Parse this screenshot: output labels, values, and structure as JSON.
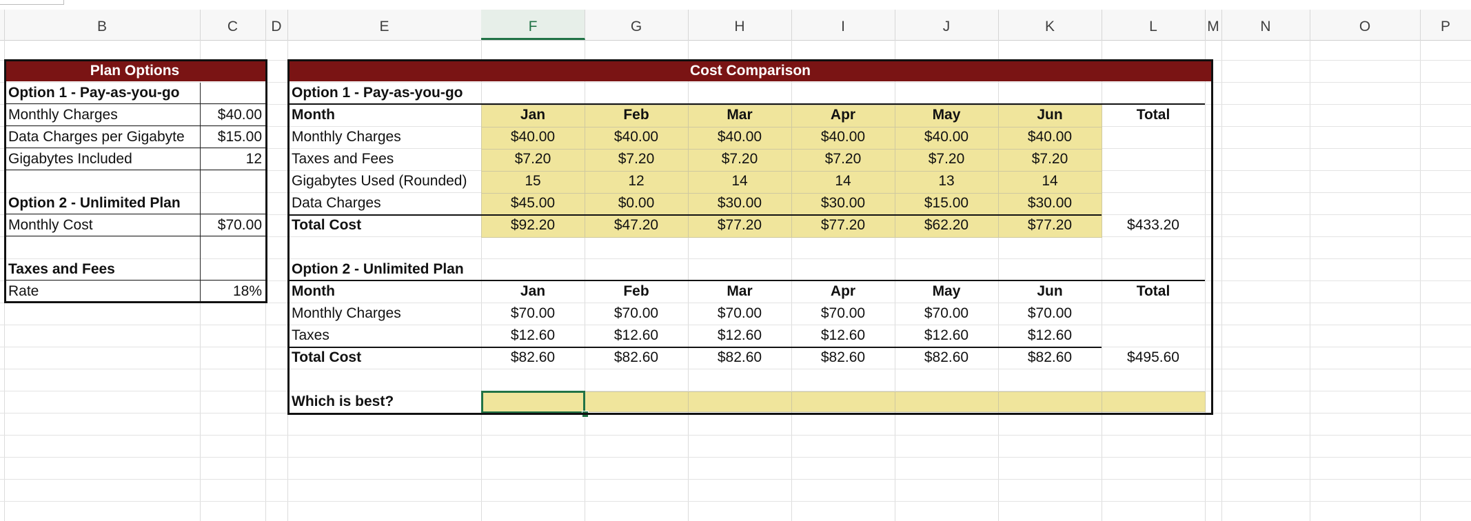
{
  "columns": [
    "B",
    "C",
    "D",
    "E",
    "F",
    "G",
    "H",
    "I",
    "J",
    "K",
    "L",
    "M",
    "N",
    "O",
    "P"
  ],
  "plan_options": {
    "title": "Plan Options",
    "opt1_label": "Option 1 - Pay-as-you-go",
    "monthly_charges_label": "Monthly Charges",
    "monthly_charges_value": "$40.00",
    "data_charges_label": "Data Charges per Gigabyte",
    "data_charges_value": "$15.00",
    "gb_included_label": "Gigabytes Included",
    "gb_included_value": "12",
    "opt2_label": "Option 2 - Unlimited Plan",
    "monthly_cost_label": "Monthly Cost",
    "monthly_cost_value": "$70.00",
    "taxes_label": "Taxes and Fees",
    "rate_label": "Rate",
    "rate_value": "18%"
  },
  "comparison": {
    "title": "Cost Comparison",
    "opt1": {
      "label": "Option 1 - Pay-as-you-go",
      "month_label": "Month",
      "months": [
        "Jan",
        "Feb",
        "Mar",
        "Apr",
        "May",
        "Jun"
      ],
      "total_label": "Total",
      "rows": [
        {
          "label": "Monthly Charges",
          "values": [
            "$40.00",
            "$40.00",
            "$40.00",
            "$40.00",
            "$40.00",
            "$40.00"
          ]
        },
        {
          "label": "Taxes and Fees",
          "values": [
            "$7.20",
            "$7.20",
            "$7.20",
            "$7.20",
            "$7.20",
            "$7.20"
          ]
        },
        {
          "label": "Gigabytes Used (Rounded)",
          "values": [
            "15",
            "12",
            "14",
            "14",
            "13",
            "14"
          ]
        },
        {
          "label": "Data Charges",
          "values": [
            "$45.00",
            "$0.00",
            "$30.00",
            "$30.00",
            "$15.00",
            "$30.00"
          ]
        }
      ],
      "total_cost_label": "Total Cost",
      "total_cost_values": [
        "$92.20",
        "$47.20",
        "$77.20",
        "$77.20",
        "$62.20",
        "$77.20"
      ],
      "grand_total": "$433.20"
    },
    "opt2": {
      "label": "Option 2 - Unlimited Plan",
      "month_label": "Month",
      "months": [
        "Jan",
        "Feb",
        "Mar",
        "Apr",
        "May",
        "Jun"
      ],
      "total_label": "Total",
      "rows": [
        {
          "label": "Monthly Charges",
          "values": [
            "$70.00",
            "$70.00",
            "$70.00",
            "$70.00",
            "$70.00",
            "$70.00"
          ]
        },
        {
          "label": "Taxes",
          "values": [
            "$12.60",
            "$12.60",
            "$12.60",
            "$12.60",
            "$12.60",
            "$12.60"
          ]
        }
      ],
      "total_cost_label": "Total Cost",
      "total_cost_values": [
        "$82.60",
        "$82.60",
        "$82.60",
        "$82.60",
        "$82.60",
        "$82.60"
      ],
      "grand_total": "$495.60"
    },
    "which_label": "Which is best?",
    "which_value": ""
  },
  "colors": {
    "header_fill": "#7a1414",
    "input_fill": "#f0e59c",
    "selection": "#217346"
  }
}
